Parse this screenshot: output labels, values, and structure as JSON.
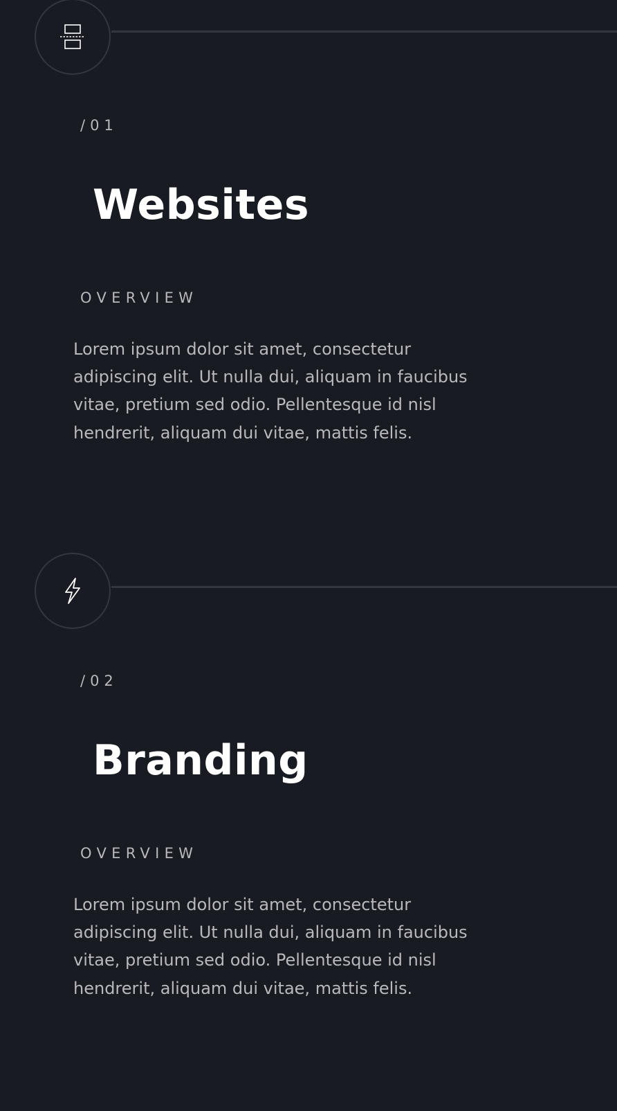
{
  "services": [
    {
      "icon": "split-layout-icon",
      "number": "/01",
      "title": "Websites",
      "section_label": "OVERVIEW",
      "description": "Lorem ipsum dolor sit amet, consectetur adipiscing elit. Ut nulla dui, aliquam in faucibus vitae, pretium sed odio. Pellentesque id nisl hendrerit, aliquam dui vitae, mattis felis."
    },
    {
      "icon": "lightning-bolt-icon",
      "number": "/02",
      "title": "Branding",
      "section_label": "OVERVIEW",
      "description": "Lorem ipsum dolor sit amet, consectetur adipiscing elit. Ut nulla dui, aliquam in faucibus vitae, pretium sed odio. Pellentesque id nisl hendrerit, aliquam dui vitae, mattis felis."
    }
  ],
  "colors": {
    "background": "#181b22",
    "heading": "#ffffff",
    "muted_text": "#b7b9bd",
    "line": "#33363d"
  }
}
